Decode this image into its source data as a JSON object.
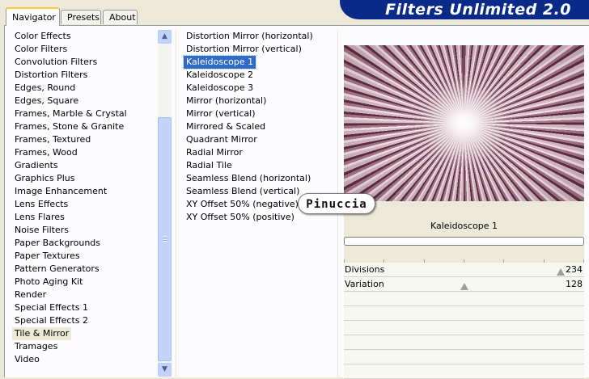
{
  "tabs": [
    "Navigator",
    "Presets",
    "About"
  ],
  "banner_title": "Filters Unlimited 2.0",
  "categories": [
    "Color Effects",
    "Color Filters",
    "Convolution Filters",
    "Distortion Filters",
    "Edges, Round",
    "Edges, Square",
    "Frames, Marble & Crystal",
    "Frames, Stone & Granite",
    "Frames, Textured",
    "Frames, Wood",
    "Gradients",
    "Graphics Plus",
    "Image Enhancement",
    "Lens Effects",
    "Lens Flares",
    "Noise Filters",
    "Paper Backgrounds",
    "Paper Textures",
    "Pattern Generators",
    "Photo Aging Kit",
    "Render",
    "Special Effects 1",
    "Special Effects 2",
    "Tile & Mirror",
    "Tramages",
    "Video"
  ],
  "selected_category": "Tile & Mirror",
  "filters": [
    "Distortion Mirror (horizontal)",
    "Distortion Mirror (vertical)",
    "Kaleidoscope 1",
    "Kaleidoscope 2",
    "Kaleidoscope 3",
    "Mirror (horizontal)",
    "Mirror (vertical)",
    "Mirrored & Scaled",
    "Quadrant Mirror",
    "Radial Mirror",
    "Radial Tile",
    "Seamless Blend (horizontal)",
    "Seamless Blend (vertical)",
    "XY Offset 50% (negative)",
    "XY Offset 50% (positive)"
  ],
  "selected_filter": "Kaleidoscope 1",
  "current_filter_name": "Kaleidoscope 1",
  "watermark_text": "Pinuccia",
  "params": [
    {
      "label": "Divisions",
      "value": "234",
      "level": 0.918
    },
    {
      "label": "Variation",
      "value": "128",
      "level": 0.502
    }
  ],
  "colors": {
    "selection": "#316AC5",
    "banner": "#0A2A8A",
    "tab_highlight": "#FFC73C"
  }
}
